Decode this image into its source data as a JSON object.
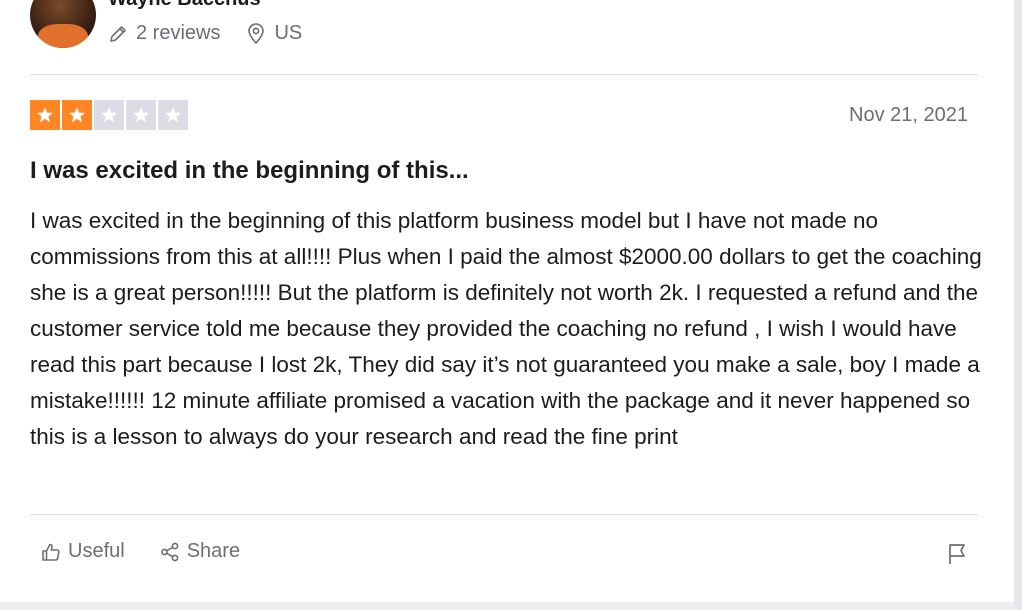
{
  "reviewer": {
    "name": "Wayne Bacchus",
    "reviews_count": "2 reviews",
    "country": "US"
  },
  "review": {
    "rating": 2,
    "max_rating": 5,
    "date": "Nov 21, 2021",
    "title": "I was excited in the beginning of this...",
    "body": "I was excited in the beginning of this platform business model but I have not made no commissions from this at all!!!! Plus when I paid the almost $2000.00 dollars to get the coaching she is a great person!!!!! But the platform is definitely not worth 2k. I requested a refund and the customer service told me because they provided the coaching no refund , I wish I would have read this part because I lost 2k, They did say it’s not guaranteed you make a sale, boy I made a mistake!!!!!! 12 minute affiliate promised a vacation with the package and it never happened so this is a lesson to always do your research and read the fine print"
  },
  "actions": {
    "useful_label": "Useful",
    "share_label": "Share"
  },
  "icons": {
    "reviews": "pencil-icon",
    "location": "location-pin-icon",
    "useful": "thumbs-up-icon",
    "share": "share-icon",
    "report": "flag-icon",
    "star": "star-icon"
  },
  "colors": {
    "star_on": "#ff8622",
    "star_off": "#dcdce6",
    "muted_text": "#6b6e73"
  }
}
